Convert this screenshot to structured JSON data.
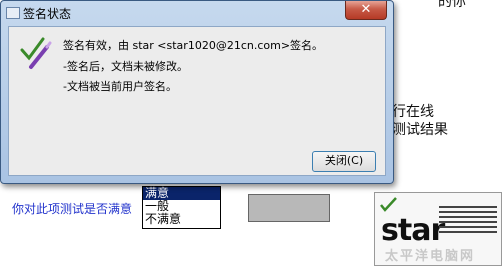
{
  "dialog": {
    "title": "签名状态",
    "close_glyph": "✕",
    "messages": [
      "签名有效，由 star <star1020@21cn.com>签名。",
      "-签名后，文档未被修改。",
      "-文档被当前用户签名。"
    ],
    "close_button_label": "关闭(C)"
  },
  "background": {
    "top_right_text": "的你",
    "mid_right_line1": "行在线",
    "mid_right_line2": "测试结果",
    "question": "你对此项测试是否满意",
    "satisfaction_options": [
      "满意",
      "一般",
      "不满意"
    ],
    "selected_option": "满意",
    "thumbnail_word": "star",
    "watermark": "太平洋电脑网"
  },
  "colors": {
    "selection": "#0a246a",
    "question_text": "#2233cc",
    "check_green": "#3a8a2a",
    "pen_purple": "#7a3fb0"
  }
}
